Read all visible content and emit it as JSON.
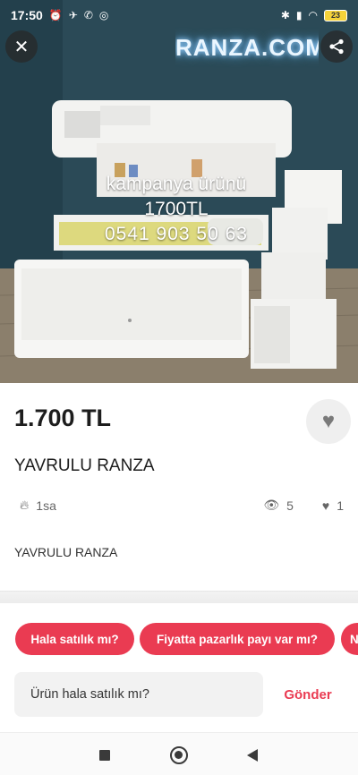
{
  "status_bar": {
    "time": "17:50",
    "left_icons": [
      "alarm-icon",
      "bird-icon",
      "whatsapp-icon",
      "instagram-icon"
    ],
    "right_icons": [
      "bluetooth-icon",
      "signal-icon",
      "wifi-icon"
    ],
    "battery": "23"
  },
  "photo": {
    "sign_text": "RANZA.COM",
    "caption_line1": "kampanya ürünü",
    "caption_line2": "1700TL",
    "caption_line3": "0541 903 50 63"
  },
  "listing": {
    "price": "1.700 TL",
    "title": "YAVRULU RANZA",
    "posted_ago": "1sa",
    "views": "5",
    "likes": "1",
    "description": "YAVRULU RANZA"
  },
  "quick_questions": [
    "Hala satılık mı?",
    "Fiyatta pazarlık payı var mı?",
    "N"
  ],
  "message": {
    "input_value": "Ürün hala satılık mı?",
    "send_label": "Gönder"
  },
  "colors": {
    "accent": "#ea3b52",
    "input_bg": "#f2f2f2"
  }
}
